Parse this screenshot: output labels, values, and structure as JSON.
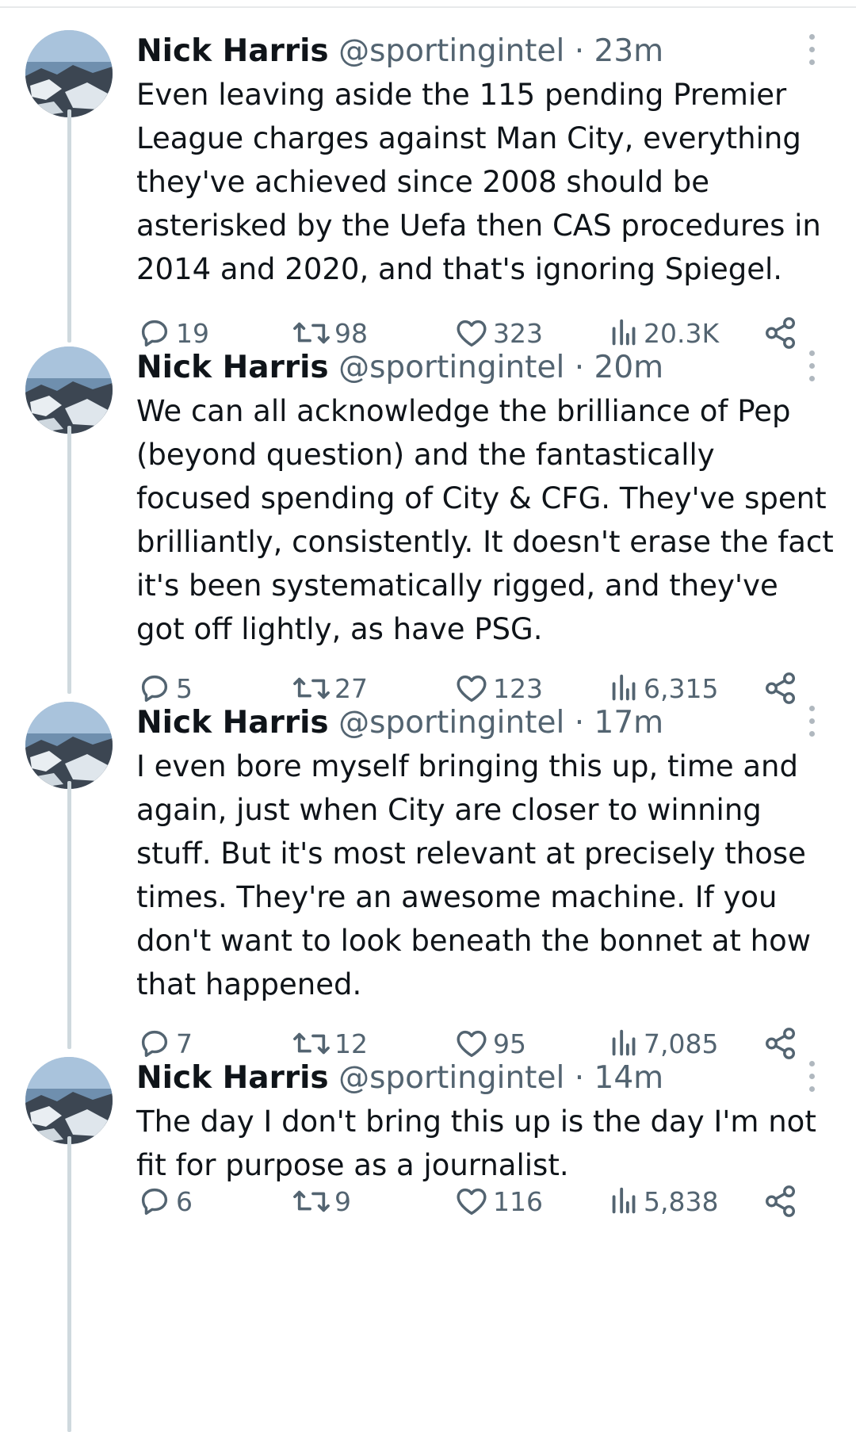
{
  "tweets": [
    {
      "author": "Nick Harris",
      "handle": "@sportingintel",
      "separator": "·",
      "time": "23m",
      "text": "Even leaving aside the 115 pending Premier League charges against Man City, everything they've achieved since 2008 should be asterisked by the Uefa then CAS procedures in 2014 and 2020, and that's ignoring Spiegel.",
      "replies": "19",
      "retweets": "98",
      "likes": "323",
      "views": "20.3K"
    },
    {
      "author": "Nick Harris",
      "handle": "@sportingintel",
      "separator": "·",
      "time": "20m",
      "text": "We can all acknowledge the brilliance of Pep (beyond question) and the fantastically focused spending of City & CFG. They've spent brilliantly, consistently. It doesn't erase the fact it's been systematically rigged, and they've got off lightly, as have PSG.",
      "replies": "5",
      "retweets": "27",
      "likes": "123",
      "views": "6,315"
    },
    {
      "author": "Nick Harris",
      "handle": "@sportingintel",
      "separator": "·",
      "time": "17m",
      "text": "I even bore myself bringing this up, time and again, just when City are closer to winning stuff. But it's most relevant at precisely those times. They're an awesome machine. If you don't want to look beneath the bonnet at how that happened.",
      "replies": "7",
      "retweets": "12",
      "likes": "95",
      "views": "7,085"
    },
    {
      "author": "Nick Harris",
      "handle": "@sportingintel",
      "separator": "·",
      "time": "14m",
      "text": "The day I don't bring this up is the day I'm not fit for purpose as a journalist.",
      "replies": "6",
      "retweets": "9",
      "likes": "116",
      "views": "5,838"
    }
  ],
  "icons": {
    "reply": "reply-icon",
    "retweet": "retweet-icon",
    "like": "heart-icon",
    "views": "views-icon",
    "share": "share-icon",
    "more": "more-vertical-icon"
  },
  "colors": {
    "text": "#0f1419",
    "secondary": "#536471",
    "thread_line": "#cfd9de"
  }
}
